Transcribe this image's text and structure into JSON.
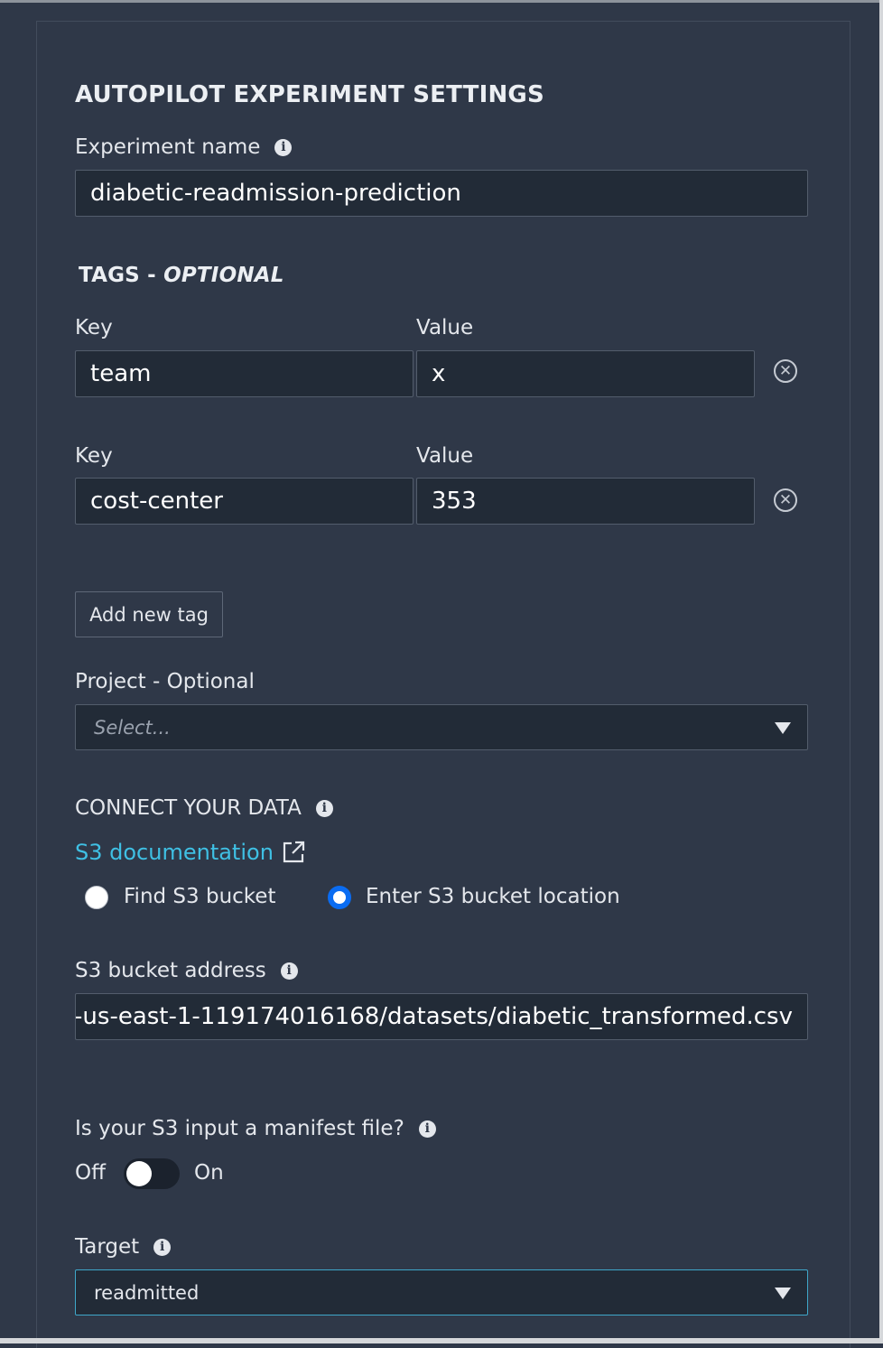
{
  "header": {
    "title": "AUTOPILOT EXPERIMENT SETTINGS"
  },
  "experiment": {
    "label": "Experiment name",
    "value": "diabetic-readmission-prediction"
  },
  "tags": {
    "title_prefix": "TAGS - ",
    "title_optional": "OPTIONAL",
    "rows": [
      {
        "key_label": "Key",
        "value_label": "Value",
        "key": "team",
        "value": "x"
      },
      {
        "key_label": "Key",
        "value_label": "Value",
        "key": "cost-center",
        "value": "353"
      }
    ],
    "add_button": "Add new tag"
  },
  "project": {
    "label": "Project - Optional",
    "placeholder": "Select..."
  },
  "connect": {
    "title": "CONNECT YOUR DATA",
    "doc_link": "S3 documentation",
    "radio_find": "Find S3 bucket",
    "radio_enter": "Enter S3 bucket location",
    "selected": "enter"
  },
  "s3": {
    "label": "S3 bucket address",
    "value": "-us-east-1-119174016168/datasets/diabetic_transformed.csv"
  },
  "manifest": {
    "label": "Is your S3 input a manifest file?",
    "off_label": "Off",
    "on_label": "On",
    "enabled": false
  },
  "target": {
    "label": "Target",
    "value": "readmitted"
  },
  "icons": {
    "info": "info-icon",
    "remove": "remove-circle-icon",
    "external": "external-link-icon",
    "caret": "caret-down-icon"
  },
  "colors": {
    "background": "#2f3848",
    "input_bg": "#222b37",
    "link": "#3fc0e4",
    "radio_selected": "#0a6cf2"
  }
}
